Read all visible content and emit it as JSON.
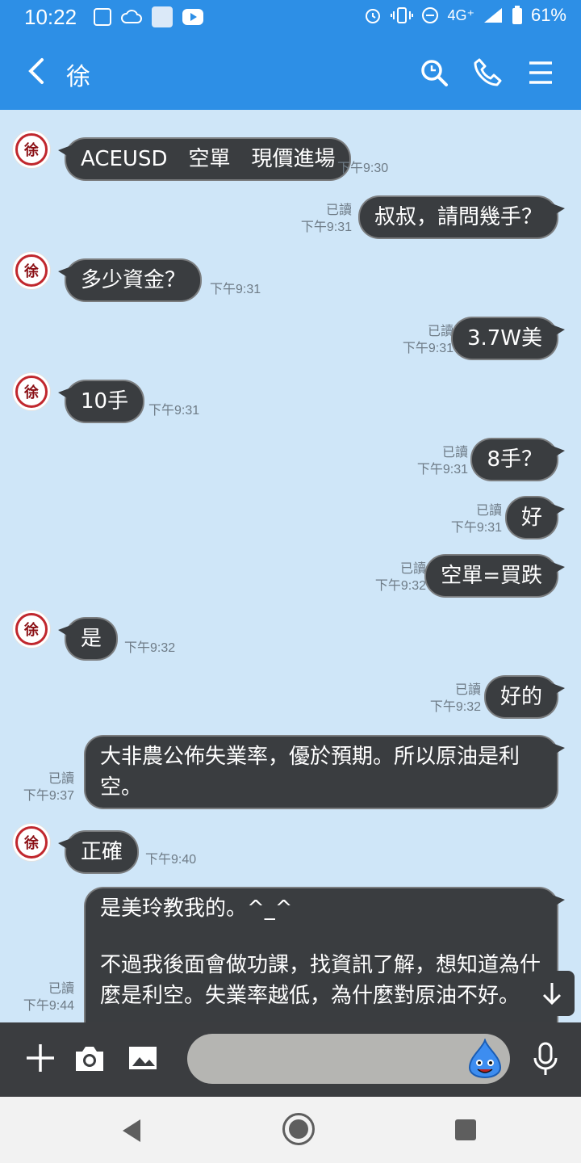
{
  "status_bar": {
    "time": "10:22",
    "network": "4G⁺",
    "battery": "61%"
  },
  "header": {
    "title": "徐",
    "back_icon": "chevron-left-icon",
    "search_icon": "search-icon",
    "call_icon": "phone-icon",
    "menu_icon": "hamburger-menu-icon"
  },
  "contact": {
    "avatar_char": "徐"
  },
  "messages": [
    {
      "side": "left",
      "text": "ACEUSD　空單　現價進場",
      "time": "下午9:30"
    },
    {
      "side": "right",
      "text": "叔叔，請問幾手？",
      "read": "已讀",
      "time": "下午9:31"
    },
    {
      "side": "left",
      "text": "多少資金？",
      "time": "下午9:31"
    },
    {
      "side": "right",
      "text": "3.7W美",
      "read": "已讀",
      "time": "下午9:31"
    },
    {
      "side": "left",
      "text": "10手",
      "time": "下午9:31"
    },
    {
      "side": "right",
      "text": "8手？",
      "read": "已讀",
      "time": "下午9:31"
    },
    {
      "side": "right",
      "text": "好",
      "read": "已讀",
      "time": "下午9:31"
    },
    {
      "side": "right",
      "text": "空單=買跌",
      "read": "已讀",
      "time": "下午9:32"
    },
    {
      "side": "left",
      "text": "是",
      "time": "下午9:32"
    },
    {
      "side": "right",
      "text": "好的",
      "read": "已讀",
      "time": "下午9:32"
    },
    {
      "side": "right",
      "line1": "大非農公佈失業率，優於預期。所以原油是利",
      "line2": "空。",
      "read": "已讀",
      "time": "下午9:37"
    },
    {
      "side": "left",
      "text": "正確",
      "time": "下午9:40"
    },
    {
      "side": "right",
      "line1": "是美玲教我的。^_^",
      "line2": "不過我後面會做功課，找資訊了解，想知道為什",
      "line3": "麼是利空。失業率越低，為什麼對原油不好。",
      "read": "已讀",
      "time": "下午9:44"
    }
  ],
  "input_bar": {
    "placeholder": "",
    "plus_icon": "plus-icon",
    "camera_icon": "camera-icon",
    "image_icon": "image-icon",
    "sticker_icon": "slime-sticker-icon",
    "mic_icon": "microphone-icon"
  },
  "nav": {
    "back_icon": "triangle-back-icon",
    "home_icon": "home-circle-icon",
    "recent_icon": "square-recent-icon"
  },
  "colors": {
    "header": "#2d8fe6",
    "chat_bg": "#cfe6f8",
    "bubble": "#3a3d40"
  }
}
